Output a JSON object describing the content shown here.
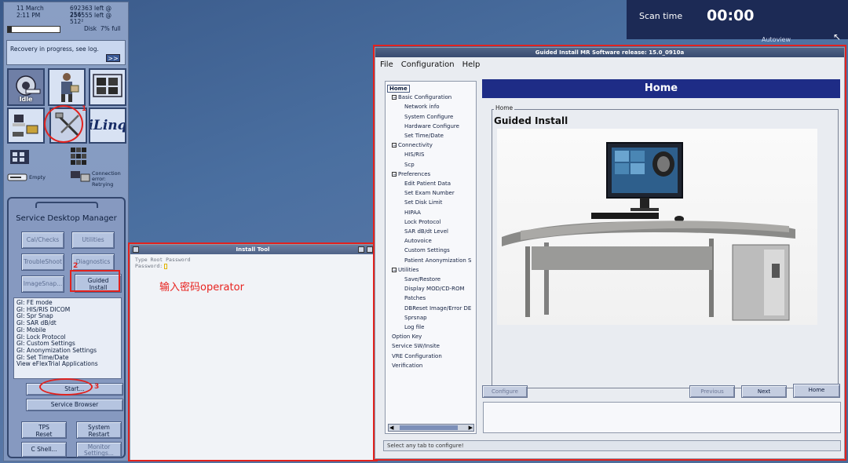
{
  "status": {
    "date": "11 March",
    "time": "2:11 PM",
    "line1_right": "692363 left @ 256²",
    "line2_right": "254555 left @ 512²",
    "disk_label": "Disk",
    "disk_percent": 7,
    "disk_text": "7% full",
    "recovery_text": "Recovery in progress, see log.",
    "recovery_arrow": ">>"
  },
  "tiles": {
    "idle_label": "Idle",
    "iling_label": "iLinq",
    "empty_label": "Empty",
    "connection_text": "Connection error: Retrying"
  },
  "sdm": {
    "title": "Service Desktop Manager",
    "buttons": {
      "calchecks": "Cal/Checks",
      "utilities": "Utilities",
      "troubleshoot": "TroubleShoot",
      "diagnostics": "Diagnostics",
      "imagesnap": "ImageSnap...",
      "guided_install_line1": "Guided",
      "guided_install_line2": "Install",
      "start": "Start...",
      "service_browser": "Service Browser",
      "tps_reset_line1": "TPS",
      "tps_reset_line2": "Reset",
      "system_restart_line1": "System",
      "system_restart_line2": "Restart",
      "c_shell": "C Shell...",
      "monitor_settings_line1": "Monitor",
      "monitor_settings_line2": "Settings..."
    },
    "list": [
      "GI: FE mode",
      "GI: HIS/RIS DICOM",
      "GI: Spr Snap",
      "GI: SAR dB/dt",
      "GI: Mobile",
      "GI: Lock Protocol",
      "GI: Custom Settings",
      "GI: Anonymization Settings",
      "GI: Set Time/Date",
      "View eFlexTrial Applications"
    ]
  },
  "annotations": {
    "num1": "1",
    "num2": "2",
    "num3": "3",
    "instruction": "输入密码operator"
  },
  "install_tool": {
    "title": "Install Tool",
    "line1": "Type Root Password",
    "line2": "Password:"
  },
  "guided_install": {
    "title": "Guided Install  MR Software release: 15.0_0910a",
    "menu": [
      "File",
      "Configuration",
      "Help"
    ],
    "tree": [
      {
        "label": "Home",
        "level": 0,
        "selected": true
      },
      {
        "label": "Basic Configuration",
        "level": 1,
        "box": "−"
      },
      {
        "label": "Network info",
        "level": 2
      },
      {
        "label": "System Configure",
        "level": 2
      },
      {
        "label": "Hardware Configure",
        "level": 2
      },
      {
        "label": "Set Time/Date",
        "level": 2
      },
      {
        "label": "Connectivity",
        "level": 1,
        "box": "−"
      },
      {
        "label": "HIS/RIS",
        "level": 2
      },
      {
        "label": "Scp",
        "level": 2
      },
      {
        "label": "Preferences",
        "level": 1,
        "box": "−"
      },
      {
        "label": "Edit Patient Data",
        "level": 2
      },
      {
        "label": "Set Exam Number",
        "level": 2
      },
      {
        "label": "Set Disk Limit",
        "level": 2
      },
      {
        "label": "HIPAA",
        "level": 2
      },
      {
        "label": "Lock Protocol",
        "level": 2
      },
      {
        "label": "SAR dB/dt Level",
        "level": 2
      },
      {
        "label": "Autovoice",
        "level": 2
      },
      {
        "label": "Custom Settings",
        "level": 2
      },
      {
        "label": "Patient Anonymization S",
        "level": 2
      },
      {
        "label": "Utilities",
        "level": 1,
        "box": "−"
      },
      {
        "label": "Save/Restore",
        "level": 2
      },
      {
        "label": "Display MOD/CD-ROM",
        "level": 2
      },
      {
        "label": "Patches",
        "level": 2
      },
      {
        "label": "DBReset Image/Error DE",
        "level": 2
      },
      {
        "label": "Sprsnap",
        "level": 2
      },
      {
        "label": "Log file",
        "level": 2
      },
      {
        "label": "Option Key",
        "level": 1
      },
      {
        "label": "Service SW/Insite",
        "level": 1
      },
      {
        "label": "VRE Configuration",
        "level": 1
      },
      {
        "label": "Verification",
        "level": 1
      }
    ],
    "header": "Home",
    "frame_legend": "Home",
    "heading": "Guided Install",
    "buttons": {
      "configure": "Configure",
      "previous": "Previous",
      "next": "Next",
      "home": "Home"
    },
    "status": "Select any tab to configure!"
  },
  "scan": {
    "label": "Scan time",
    "value": "00:00",
    "autoview": "Autoview"
  }
}
